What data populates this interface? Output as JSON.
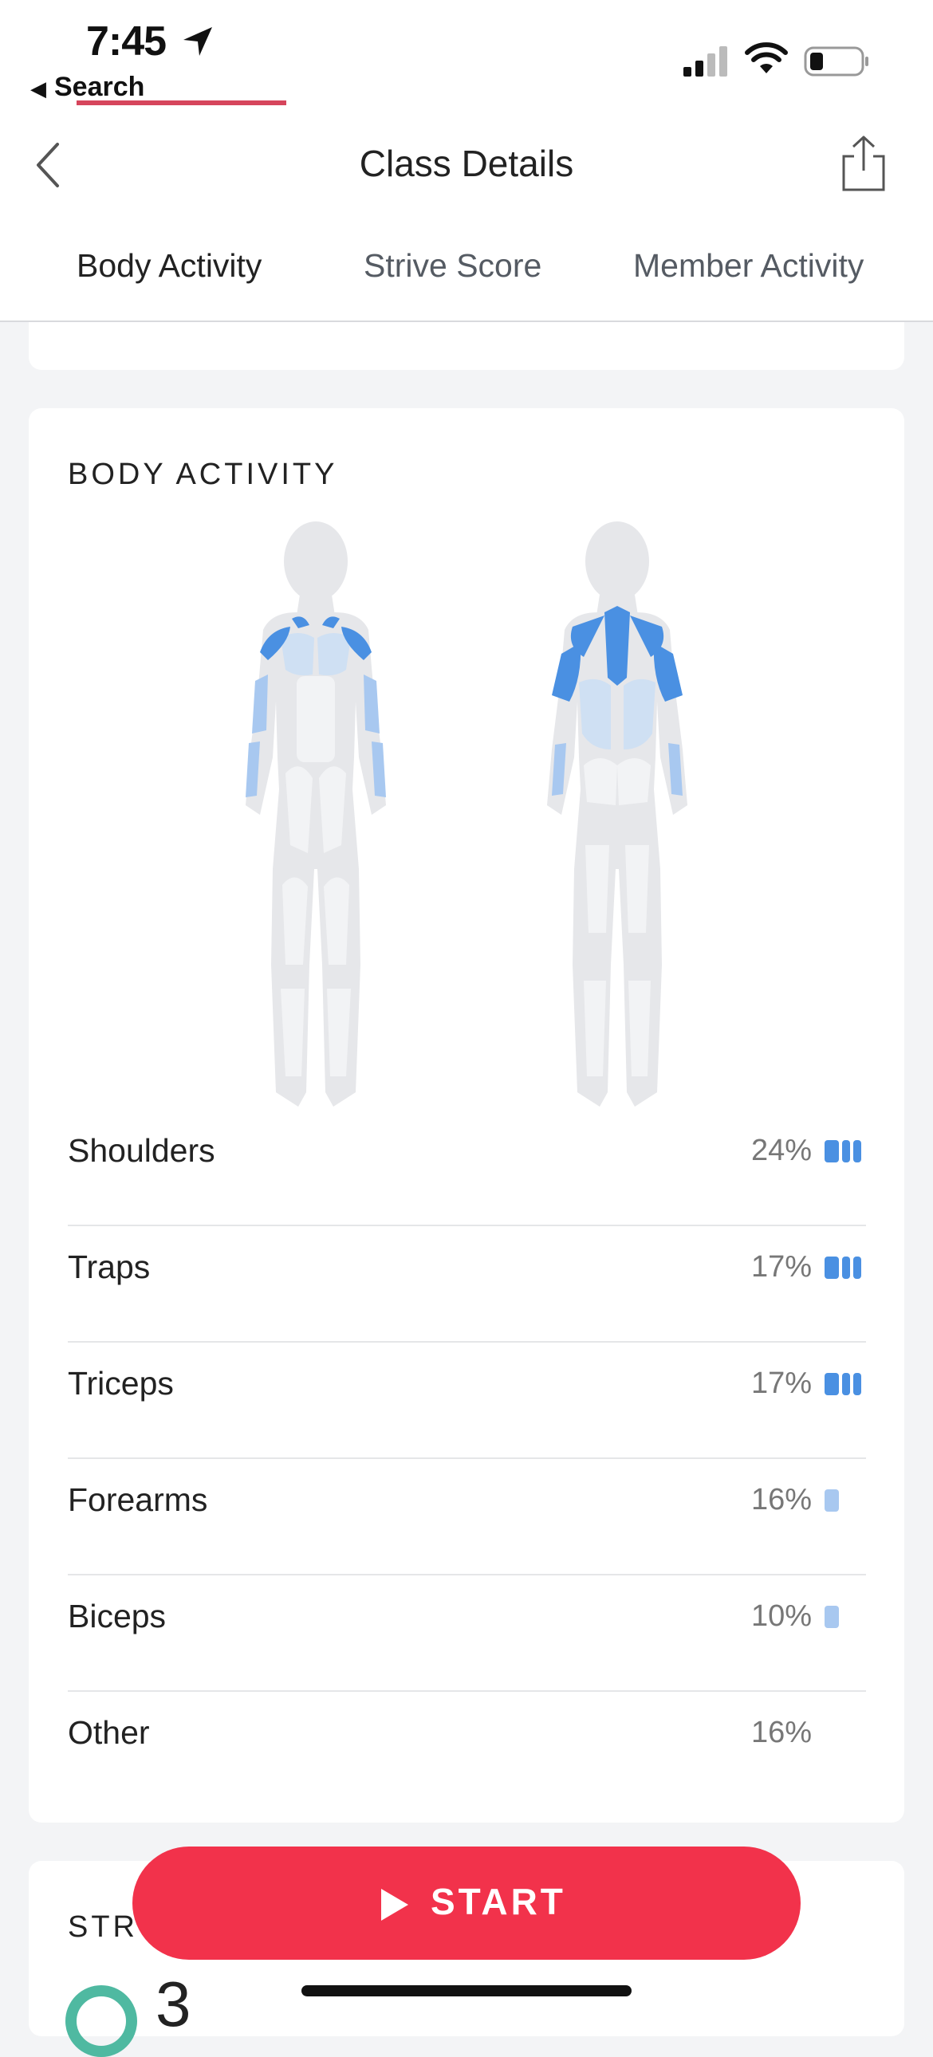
{
  "status_bar": {
    "time": "7:45",
    "back_app": "Search"
  },
  "nav": {
    "title": "Class Details",
    "back_icon": "chevron-left-icon",
    "share_icon": "share-icon"
  },
  "tabs": [
    {
      "label": "Body Activity",
      "active": true
    },
    {
      "label": "Strive Score",
      "active": false
    },
    {
      "label": "Member Activity",
      "active": false
    }
  ],
  "body_activity": {
    "title": "BODY ACTIVITY",
    "colors": {
      "high": "#4a90e2",
      "medium": "#a8c8f0",
      "inactive": "#e6e7ea"
    },
    "rows": [
      {
        "name": "Shoulders",
        "percent": "24%",
        "level": 3
      },
      {
        "name": "Traps",
        "percent": "17%",
        "level": 3
      },
      {
        "name": "Triceps",
        "percent": "17%",
        "level": 3
      },
      {
        "name": "Forearms",
        "percent": "16%",
        "level": 1
      },
      {
        "name": "Biceps",
        "percent": "10%",
        "level": 1
      },
      {
        "name": "Other",
        "percent": "16%",
        "level": 0
      }
    ]
  },
  "next_section": {
    "title_visible": "STR",
    "value_visible": "3"
  },
  "start_button": {
    "label": "START"
  },
  "colors": {
    "accent": "#f2324b",
    "tab_underline": "#d6455c",
    "strive_ring": "#4fb9a1"
  }
}
